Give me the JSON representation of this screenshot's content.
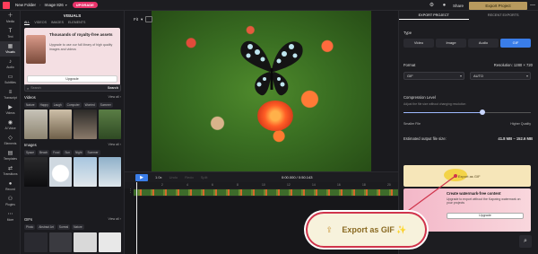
{
  "topbar": {
    "folder": "New Folder",
    "sep": "›",
    "project": "Image 826",
    "upgrade": "UPGRADE",
    "share": "Share",
    "export_btn": "Export Project"
  },
  "leftnav": {
    "items": [
      {
        "label": "Media",
        "icon": "＋"
      },
      {
        "label": "Text",
        "icon": "T"
      },
      {
        "label": "Visuals",
        "icon": "▦"
      },
      {
        "label": "Audio",
        "icon": "♪"
      },
      {
        "label": "Subtitles",
        "icon": "▭"
      },
      {
        "label": "Transcript",
        "icon": "≡"
      },
      {
        "label": "Videos",
        "icon": "▶"
      },
      {
        "label": "AI Voice",
        "icon": "◉"
      },
      {
        "label": "Elements",
        "icon": "◇"
      },
      {
        "label": "Templates",
        "icon": "▤"
      },
      {
        "label": "Transitions",
        "icon": "⇄"
      },
      {
        "label": "Record",
        "icon": "●"
      },
      {
        "label": "Plugins",
        "icon": "⚇"
      },
      {
        "label": "More",
        "icon": "⋯"
      }
    ]
  },
  "visuals": {
    "title": "VISUALS",
    "tabs": [
      "ALL",
      "VIDEOS",
      "IMAGES",
      "ELEMENTS"
    ],
    "promo_title": "Thousands of royalty-free assets",
    "promo_sub": "Upgrade to use our full library of high quality images and videos",
    "promo_btn": "Upgrade",
    "search_placeholder": "Search",
    "search_btn": "Search",
    "videos_head": "Videos",
    "view_all": "View all",
    "video_chips": [
      "Nature",
      "Happy",
      "Laugh",
      "Computer",
      "Worried",
      "Summer"
    ],
    "images_head": "Images",
    "image_chips": [
      "Space",
      "Beach",
      "Food",
      "Sun",
      "Night",
      "Summer"
    ],
    "gifs_head": "GIFs",
    "gif_chips": [
      "Photo",
      "Abstract Art",
      "Surreal",
      "Nature"
    ]
  },
  "preview": {
    "fit": "Fit"
  },
  "timeline": {
    "speed": "1.0x",
    "dim1": "Undo",
    "dim2": "Redo",
    "dim3": "Split",
    "time": "0:00.000 / 0:50.143",
    "ticks": [
      "2",
      "4",
      "6",
      "8",
      "10",
      "12",
      "14",
      "16",
      "18",
      "20",
      "22"
    ]
  },
  "export": {
    "tabs": [
      "EXPORT PROJECT",
      "RECENT EXPORTS"
    ],
    "type_label": "Type",
    "types": [
      "Video",
      "Image",
      "Audio",
      "GIF"
    ],
    "format_label": "Format",
    "resolution_label": "Resolution: 1280 × 720",
    "format_value": "GIF",
    "resolution_value": "AUTO",
    "compression_label": "Compression Level",
    "compression_hint": "Adjust the file size without changing resolution",
    "smaller": "Smaller File",
    "higher": "Higher Quality",
    "size_label": "Estimated output file size:",
    "size_value": "41.8 MB – 152.6 MB",
    "export_gif": "Export as GIF",
    "wm_title": "Create watermark-free content",
    "wm_sub": "Upgrade to export without the Kapwing watermark on your projects",
    "wm_btn": "Upgrade"
  },
  "callout": {
    "text": "Export as GIF ✨"
  },
  "colors": {
    "accent": "#3a7de8",
    "export_gold": "#b89a5e",
    "callout_border": "#d0344c",
    "upgrade_pink": "#e8336a"
  },
  "selected_type": "GIF",
  "compression_level": 0.62
}
